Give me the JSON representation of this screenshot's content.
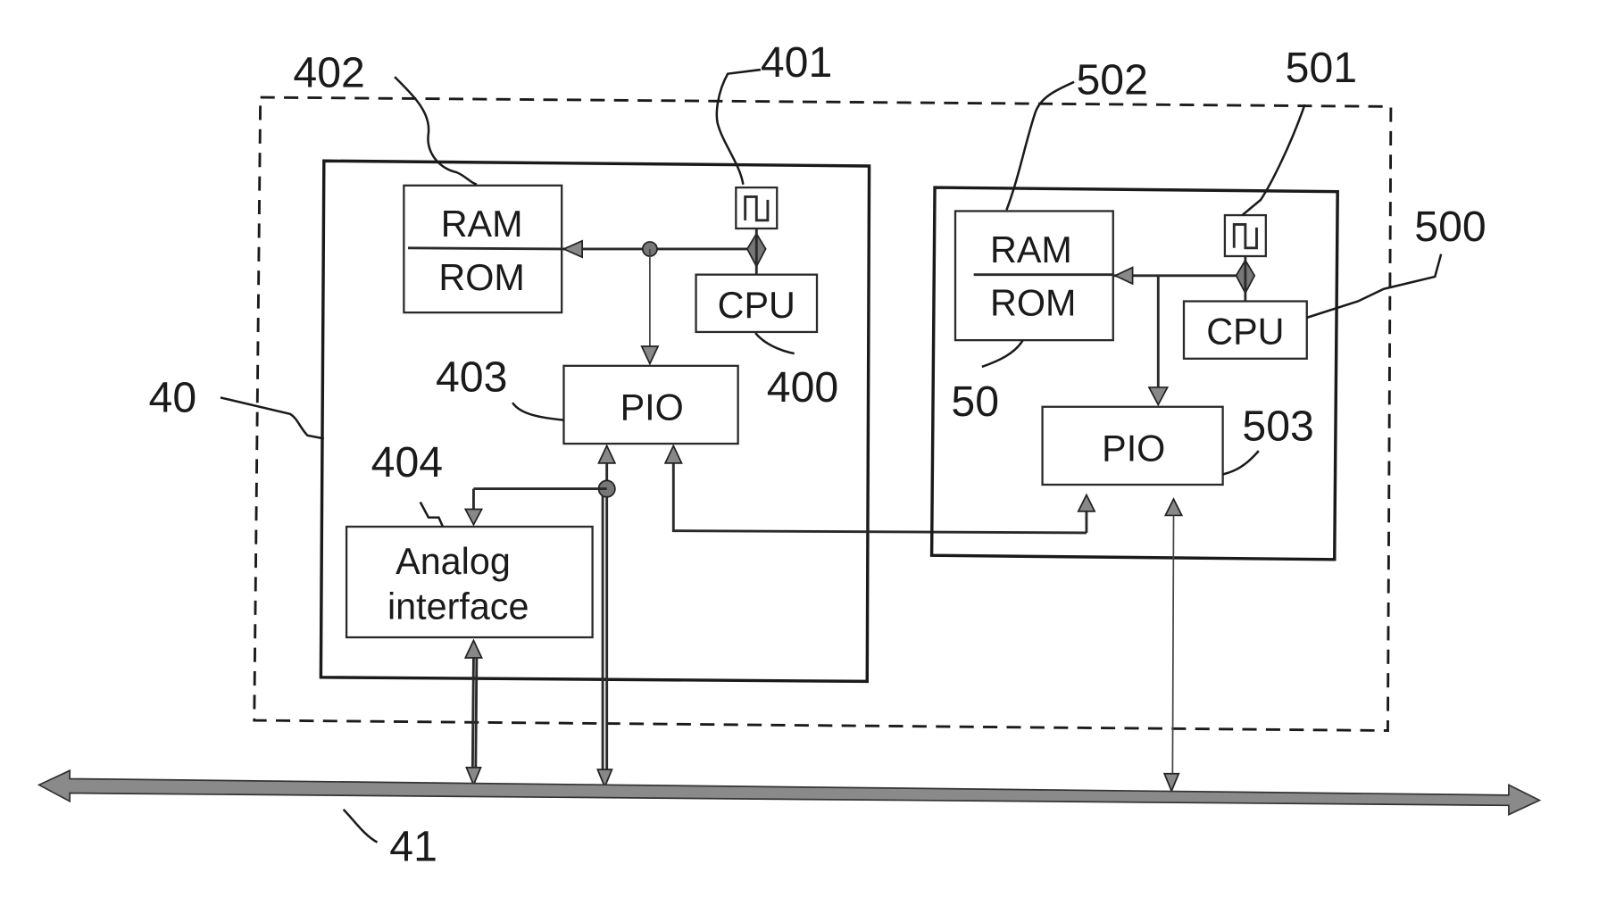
{
  "diagram": {
    "outer_system_label": "",
    "bus": {
      "ref": "41"
    },
    "module_left": {
      "ref": "40",
      "memory": {
        "line1": "RAM",
        "line2": "ROM",
        "ref": "402"
      },
      "clock": {
        "glyph": "⎍",
        "ref": "401"
      },
      "cpu": {
        "label": "CPU",
        "ref": "400"
      },
      "pio": {
        "label": "PIO",
        "ref": "403"
      },
      "analog": {
        "line1": "Analog",
        "line2": "interface",
        "ref": "404"
      }
    },
    "module_right": {
      "ref": "50",
      "memory": {
        "line1": "RAM",
        "line2": "ROM",
        "ref": "502"
      },
      "clock": {
        "glyph": "⎍",
        "ref": "501"
      },
      "cpu": {
        "label": "CPU",
        "ref": "500"
      },
      "pio": {
        "label": "PIO",
        "ref": "503"
      }
    }
  }
}
